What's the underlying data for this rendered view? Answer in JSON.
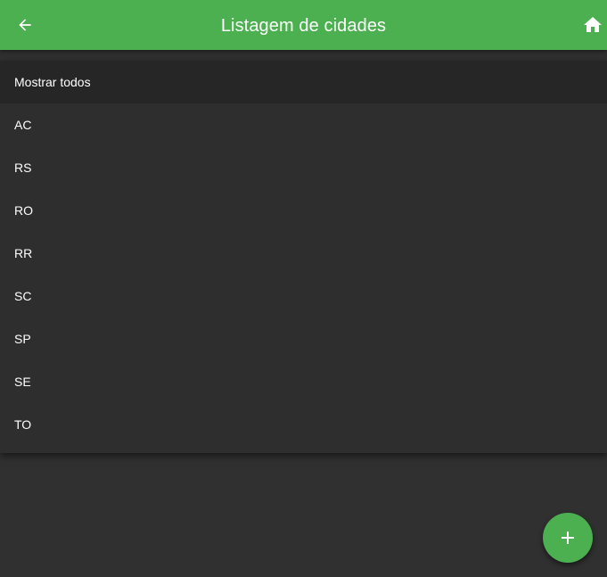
{
  "colors": {
    "primary": "#4caf50",
    "background": "#303030",
    "menu_background": "#2e2e2e",
    "text": "#ffffff"
  },
  "app_bar": {
    "title": "Listagem de cidades",
    "back_icon": "arrow-back-icon",
    "home_icon": "home-icon"
  },
  "filter_menu": {
    "items": [
      {
        "label": "Mostrar todos",
        "selected": true
      },
      {
        "label": "AC",
        "selected": false
      },
      {
        "label": "RS",
        "selected": false
      },
      {
        "label": "RO",
        "selected": false
      },
      {
        "label": "RR",
        "selected": false
      },
      {
        "label": "SC",
        "selected": false
      },
      {
        "label": "SP",
        "selected": false
      },
      {
        "label": "SE",
        "selected": false
      },
      {
        "label": "TO",
        "selected": false
      }
    ]
  },
  "fab": {
    "icon": "add-icon"
  }
}
